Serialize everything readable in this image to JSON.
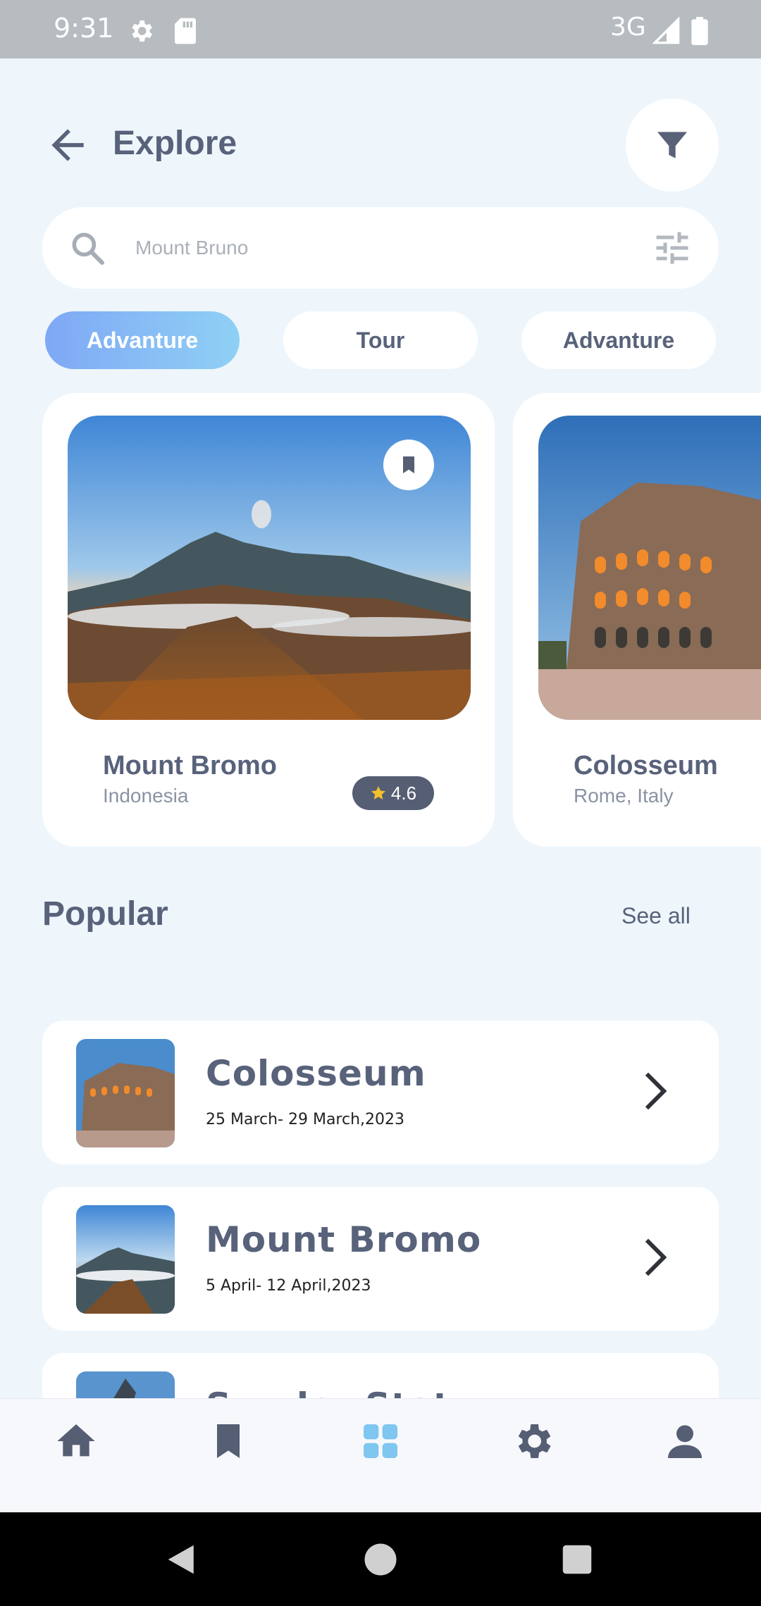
{
  "status_bar": {
    "time": "9:31",
    "network": "3G",
    "icons": [
      "settings-icon",
      "sd-card-icon",
      "signal-icon",
      "battery-icon"
    ]
  },
  "header": {
    "title": "Explore",
    "back_icon": "arrow-left-icon",
    "filter_icon": "funnel-icon"
  },
  "search": {
    "placeholder": "Mount Bruno",
    "value": ""
  },
  "chips": [
    {
      "label": "Advanture",
      "active": true
    },
    {
      "label": "Tour",
      "active": false
    },
    {
      "label": "Advanture",
      "active": false
    }
  ],
  "destinations": [
    {
      "name": "Mount Bromo",
      "location": "Indonesia",
      "rating": "4.6",
      "bookmarked": true
    },
    {
      "name": "Colosseum",
      "location": "Rome, Italy"
    }
  ],
  "popular": {
    "title": "Popular",
    "see_all": "See all",
    "items": [
      {
        "title": "Colosseum",
        "dates": "25 March- 29 March,2023"
      },
      {
        "title": "Mount Bromo",
        "dates": "5 April- 12 April,2023"
      },
      {
        "title": "Sunder Stat",
        "dates": ""
      }
    ]
  },
  "bottom_nav": {
    "items": [
      "home-icon",
      "bookmark-icon",
      "grid-icon",
      "settings-icon",
      "profile-icon"
    ],
    "active_index": 2
  },
  "colors": {
    "primary_text": "#58627a",
    "accent": "#7fc6f0",
    "background": "#eef6fc"
  }
}
